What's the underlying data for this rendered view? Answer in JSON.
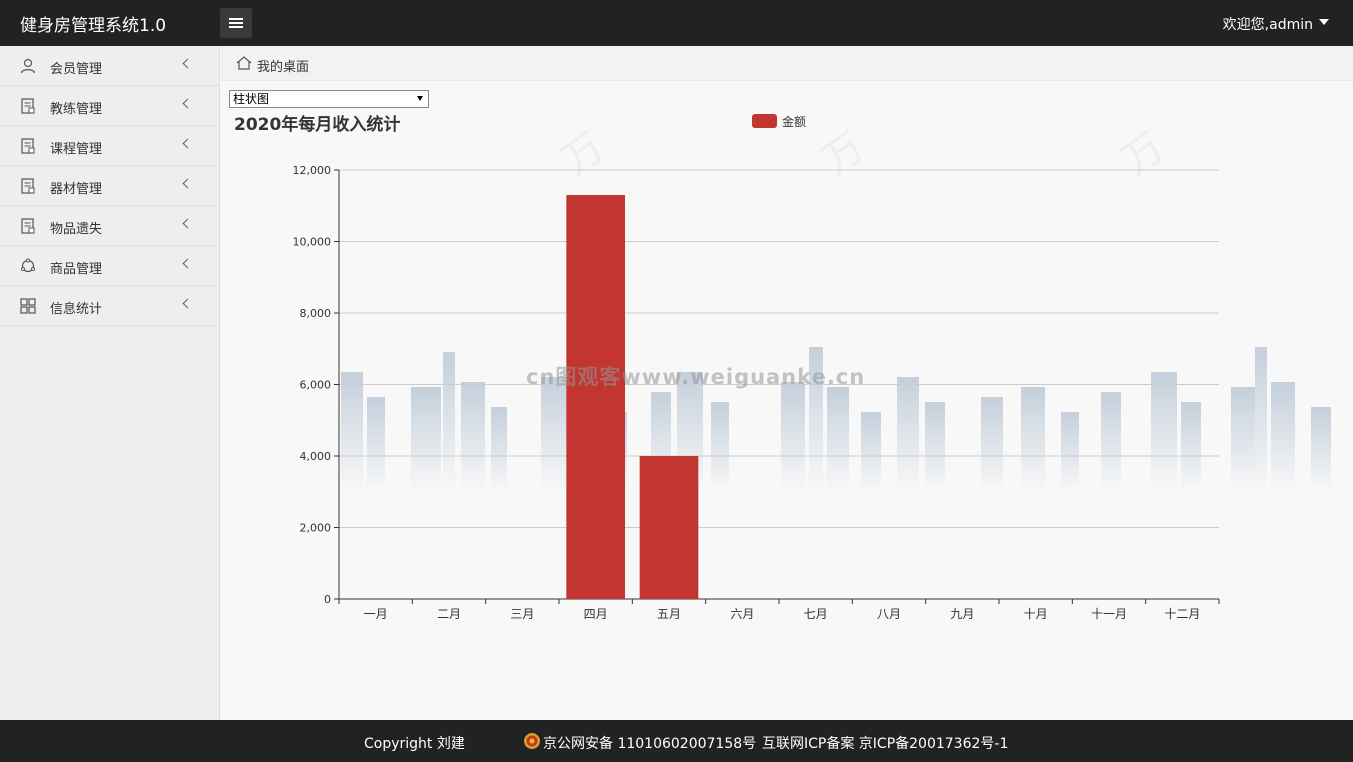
{
  "header": {
    "app_title": "健身房管理系统1.0",
    "welcome": "欢迎您,admin"
  },
  "sidebar": {
    "items": [
      {
        "label": "会员管理",
        "icon": "user-icon"
      },
      {
        "label": "教练管理",
        "icon": "document-icon"
      },
      {
        "label": "课程管理",
        "icon": "document-icon"
      },
      {
        "label": "器材管理",
        "icon": "document-icon"
      },
      {
        "label": "物品遗失",
        "icon": "document-icon"
      },
      {
        "label": "商品管理",
        "icon": "network-icon"
      },
      {
        "label": "信息统计",
        "icon": "grid-icon"
      }
    ]
  },
  "breadcrumb": {
    "label": "我的桌面"
  },
  "chart_select": {
    "selected": "柱状图"
  },
  "watermark": "cn图观客www.weiguanke.cn",
  "chart_data": {
    "type": "bar",
    "title": "2020年每月收入统计",
    "categories": [
      "一月",
      "二月",
      "三月",
      "四月",
      "五月",
      "六月",
      "七月",
      "八月",
      "九月",
      "十月",
      "十一月",
      "十二月"
    ],
    "series": [
      {
        "name": "金额",
        "values": [
          0,
          0,
          0,
          11300,
          4000,
          0,
          0,
          0,
          0,
          0,
          0,
          0
        ],
        "color": "#c23531"
      }
    ],
    "ylim": [
      0,
      12000
    ],
    "yticks": [
      0,
      2000,
      4000,
      6000,
      8000,
      10000,
      12000
    ],
    "ytick_labels": [
      "0",
      "2,000",
      "4,000",
      "6,000",
      "8,000",
      "10,000",
      "12,000"
    ],
    "grid": true,
    "legend_position": "top-center"
  },
  "footer": {
    "copyright": "Copyright 刘建",
    "police_beian": "京公网安备 11010602007158号",
    "icp": "互联网ICP备案 京ICP备20017362号-1"
  },
  "colors": {
    "topbar": "#222222",
    "bar": "#c23531",
    "sidebar": "#eeeeee"
  }
}
